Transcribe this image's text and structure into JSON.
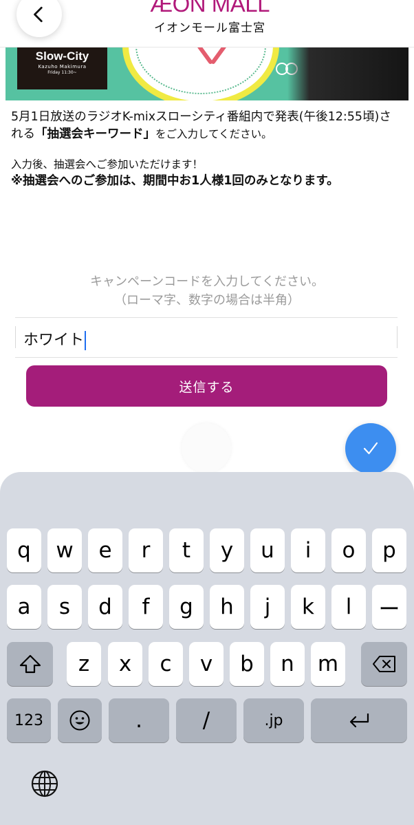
{
  "header": {
    "logo_text": "ÆON MALL",
    "mall_name": "イオンモール富士宮"
  },
  "banner": {
    "title": "Slow-City",
    "host": "Kazuho Makimura",
    "schedule": "Friday 11:30~"
  },
  "content": {
    "intro_part1": "5月1日放送のラジオK-mixスローシティ番組内で発表(午後12:55頃)される",
    "intro_keyword": "「抽選会キーワード」",
    "intro_part2": "をご入力してください。",
    "after_input": "入力後、抽選会へご参加いただけます！",
    "notice": "※抽選会へのご参加は、期間中お1人様1回のみとなります。"
  },
  "form": {
    "prompt_line1": "キャンペーンコードを入力してください。",
    "prompt_line2": "（ローマ字、数字の場合は半角）",
    "code_value": "ホワイト",
    "submit_label": "送信する"
  },
  "colors": {
    "brand": "#a41d7a",
    "confirm": "#3d8ef0",
    "keyboard_bg": "#d6dae2"
  },
  "keyboard": {
    "row1": [
      "q",
      "w",
      "e",
      "r",
      "t",
      "y",
      "u",
      "i",
      "o",
      "p"
    ],
    "row2": [
      "a",
      "s",
      "d",
      "f",
      "g",
      "h",
      "j",
      "k",
      "l",
      "ー"
    ],
    "row3": [
      "z",
      "x",
      "c",
      "v",
      "b",
      "n",
      "m"
    ],
    "numbers_label": "123",
    "dot_label": ".",
    "slash_label": "/",
    "jp_label": ".jp",
    "icons": [
      "shift-icon",
      "backspace-icon",
      "emoji-icon",
      "return-icon",
      "globe-icon",
      "checkmark-icon",
      "chevron-left-icon"
    ]
  }
}
